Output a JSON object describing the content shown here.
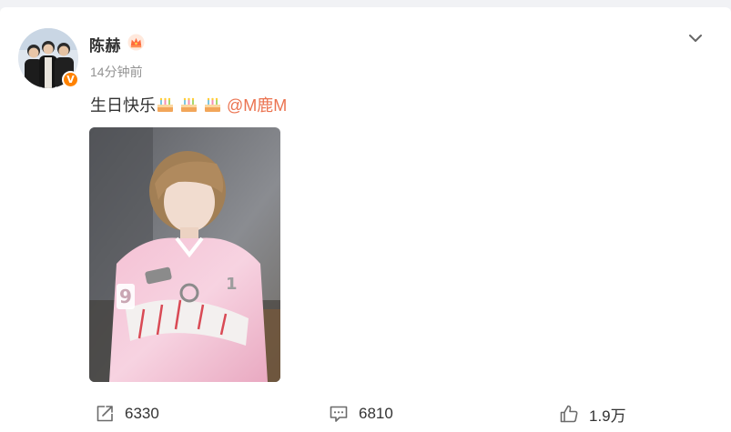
{
  "post": {
    "author": {
      "name": "陈赫",
      "avatar_icon": "avatar-photo",
      "verified_badge": "V",
      "crown_icon": "crown-icon",
      "verified_color": "#ff8200"
    },
    "timestamp": "14分钟前",
    "text": "生日快乐",
    "emoji_icon": "birthday-cake-icon",
    "emoji_count": 3,
    "mention": "@M鹿M",
    "mention_color": "#eb7350",
    "image_alt": "photo-pink-jersey"
  },
  "actions": {
    "repost": {
      "icon": "share-icon",
      "count": "6330"
    },
    "comment": {
      "icon": "comment-icon",
      "count": "6810"
    },
    "like": {
      "icon": "thumbs-up-icon",
      "count": "1.9万"
    }
  }
}
